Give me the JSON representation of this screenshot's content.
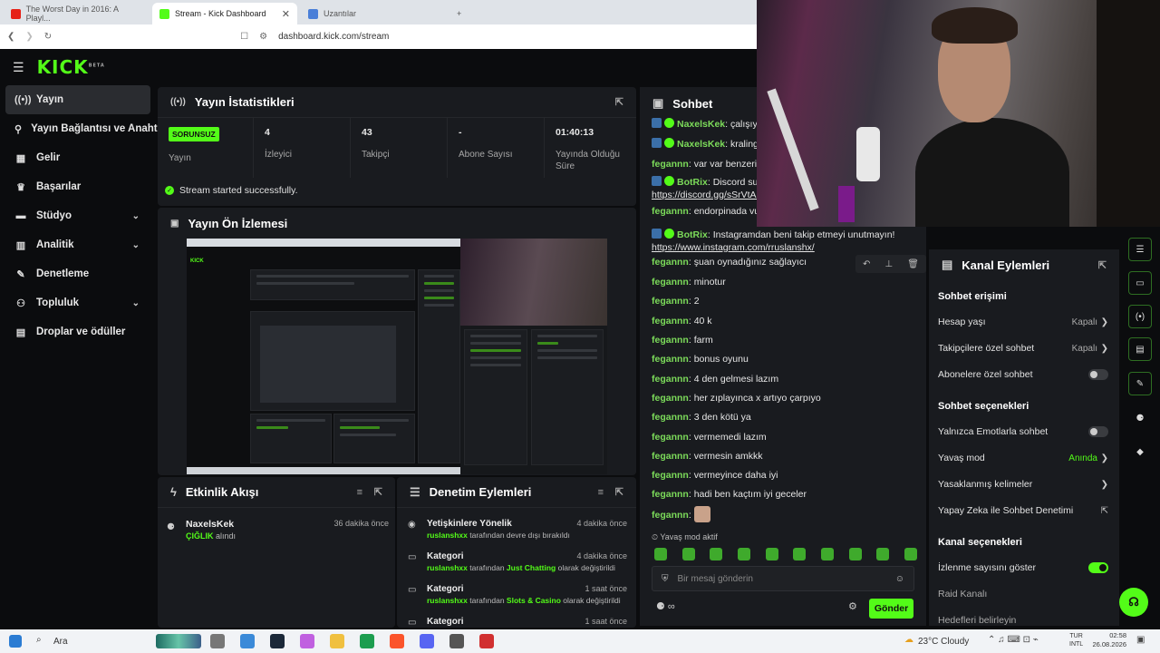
{
  "browser": {
    "tabs": [
      {
        "title": "The Worst Day in 2016: A Playl...",
        "active": false,
        "icon_color": "#e62117"
      },
      {
        "title": "Stream - Kick Dashboard",
        "active": true,
        "icon_color": "#53fc18"
      },
      {
        "title": "Uzantılar",
        "active": false,
        "icon_color": "#4a7fd8"
      }
    ],
    "new_tab": "+",
    "url": "dashboard.kick.com/stream"
  },
  "header": {
    "logo": "KICK",
    "logo_sup": "BETA"
  },
  "sidebar": {
    "items": [
      {
        "label": "Yayın",
        "icon": "broadcast-icon",
        "glyph": "((•))",
        "active": true,
        "chevron": false
      },
      {
        "label": "Yayın Bağlantısı ve Anahtarı",
        "icon": "link-icon",
        "glyph": "⚲",
        "chevron": false
      },
      {
        "label": "Gelir",
        "icon": "revenue-icon",
        "glyph": "▦",
        "chevron": false
      },
      {
        "label": "Başarılar",
        "icon": "trophy-icon",
        "glyph": "♛",
        "chevron": false
      },
      {
        "label": "Stüdyo",
        "icon": "studio-icon",
        "glyph": "▬",
        "chevron": true
      },
      {
        "label": "Analitik",
        "icon": "analytics-icon",
        "glyph": "▥",
        "chevron": true
      },
      {
        "label": "Denetleme",
        "icon": "wrench-icon",
        "glyph": "✎",
        "chevron": false
      },
      {
        "label": "Topluluk",
        "icon": "community-icon",
        "glyph": "⚇",
        "chevron": true
      },
      {
        "label": "Droplar ve ödüller",
        "icon": "drops-icon",
        "glyph": "▤",
        "chevron": false
      }
    ]
  },
  "stats": {
    "title": "Yayın İstatistikleri",
    "status_badge": "SORUNSUZ",
    "status_label": "Yayın",
    "cells": [
      {
        "value": "4",
        "label": "İzleyici"
      },
      {
        "value": "43",
        "label": "Takipçi"
      },
      {
        "value": "-",
        "label": "Abone Sayısı"
      },
      {
        "value": "01:40:13",
        "label": "Yayında Olduğu Süre"
      }
    ],
    "success": "Stream started successfully."
  },
  "preview": {
    "title": "Yayın Ön İzlemesi"
  },
  "activity": {
    "title": "Etkinlik Akışı",
    "items": [
      {
        "user": "NaxelsKek",
        "time": "36 dakika önce",
        "highlight": "ÇIĞLIK",
        "rest": "alındı"
      }
    ]
  },
  "moderation": {
    "title": "Denetim Eylemleri",
    "items": [
      {
        "title": "Yetişkinlere Yönelik",
        "time": "4 dakika önce",
        "user": "ruslanshxx",
        "text": "tarafından devre dışı bırakıldı",
        "value": "",
        "tail": ""
      },
      {
        "title": "Kategori",
        "time": "4 dakika önce",
        "user": "ruslanshxx",
        "text": "tarafından",
        "value": "Just Chatting",
        "tail": "olarak değiştirildi"
      },
      {
        "title": "Kategori",
        "time": "1 saat önce",
        "user": "ruslanshxx",
        "text": "tarafından",
        "value": "Slots & Casino",
        "tail": "olarak değiştirildi"
      },
      {
        "title": "Kategori",
        "time": "1 saat önce",
        "user": "",
        "text": "",
        "value": "",
        "tail": ""
      }
    ]
  },
  "chat": {
    "title": "Sohbet",
    "messages": [
      {
        "user": "NaxelsKek",
        "badges": "bv",
        "text": "çalışıyorum",
        "link": ""
      },
      {
        "user": "NaxelsKek",
        "badges": "bv",
        "text": "kralingo",
        "link": ""
      },
      {
        "user": "fegannn",
        "badges": "",
        "text": "var var benzeri",
        "link": ""
      },
      {
        "user": "BotRix",
        "badges": "bv",
        "text": "Discord sunucumuza katılın!",
        "link": "https://discord.gg/sSrVtAC"
      },
      {
        "user": "fegannn",
        "badges": "",
        "text": "endorpinada vurmuyor",
        "link": ""
      },
      {
        "user": "BotRix",
        "badges": "bv",
        "text": "Instagramdan beni takip etmeyi unutmayın!",
        "link": "https://www.instagram.com/rruslanshx/"
      },
      {
        "user": "fegannn",
        "badges": "",
        "text": "şuan oynadığınız sağlayıcı",
        "link": ""
      },
      {
        "user": "fegannn",
        "badges": "",
        "text": "minotur",
        "link": ""
      },
      {
        "user": "fegannn",
        "badges": "",
        "text": "2",
        "link": ""
      },
      {
        "user": "fegannn",
        "badges": "",
        "text": "40 k",
        "link": ""
      },
      {
        "user": "fegannn",
        "badges": "",
        "text": "farm",
        "link": ""
      },
      {
        "user": "fegannn",
        "badges": "",
        "text": "bonus oyunu",
        "link": ""
      },
      {
        "user": "fegannn",
        "badges": "",
        "text": "4 den gelmesi lazım",
        "link": ""
      },
      {
        "user": "fegannn",
        "badges": "",
        "text": "her zıplayınca x artıyo çarpıyo",
        "link": ""
      },
      {
        "user": "fegannn",
        "badges": "",
        "text": "3 den kötü ya",
        "link": ""
      },
      {
        "user": "fegannn",
        "badges": "",
        "text": "vermemedi lazım",
        "link": ""
      },
      {
        "user": "fegannn",
        "badges": "",
        "text": "vermesin amkkk",
        "link": ""
      },
      {
        "user": "fegannn",
        "badges": "",
        "text": "vermeyince daha iyi",
        "link": ""
      },
      {
        "user": "fegannn",
        "badges": "",
        "text": "hadi ben kaçtım iyi geceler",
        "link": ""
      },
      {
        "user": "fegannn",
        "badges": "",
        "text": "",
        "link": "",
        "emote": true
      }
    ],
    "slow_mode": "Yavaş mod aktif",
    "placeholder": "Bir mesaj gönderin",
    "send": "Gönder"
  },
  "channel_actions": {
    "title": "Kanal Eylemleri",
    "sections": [
      {
        "heading": "Sohbet erişimi",
        "rows": [
          {
            "label": "Hesap yaşı",
            "value": "Kapalı",
            "type": "arrow"
          },
          {
            "label": "Takipçilere özel sohbet",
            "value": "Kapalı",
            "type": "arrow"
          },
          {
            "label": "Abonelere özel sohbet",
            "value": "",
            "type": "toggle-off"
          }
        ]
      },
      {
        "heading": "Sohbet seçenekleri",
        "rows": [
          {
            "label": "Yalnızca Emotlarla sohbet",
            "value": "",
            "type": "toggle-off"
          },
          {
            "label": "Yavaş mod",
            "value": "Anında",
            "type": "arrow-green"
          },
          {
            "label": "Yasaklanmış kelimeler",
            "value": "",
            "type": "arrow"
          },
          {
            "label": "Yapay Zeka ile Sohbet Denetimi",
            "value": "",
            "type": "external"
          }
        ]
      },
      {
        "heading": "Kanal seçenekleri",
        "rows": [
          {
            "label": "İzlenme sayısını göster",
            "value": "",
            "type": "toggle-on"
          },
          {
            "label": "Raid Kanalı",
            "value": "",
            "type": "dim"
          },
          {
            "label": "Hedefleri belirleyin",
            "value": "",
            "type": "dim"
          }
        ]
      }
    ]
  },
  "taskbar": {
    "search": "Ara",
    "weather": "23°C  Cloudy",
    "lang": "TUR",
    "lang2": "INTL",
    "time": "02:58",
    "date": "26.08.2026"
  },
  "colors": {
    "accent": "#53fc18",
    "panel": "#191b1f",
    "bg": "#0b0c0e"
  }
}
